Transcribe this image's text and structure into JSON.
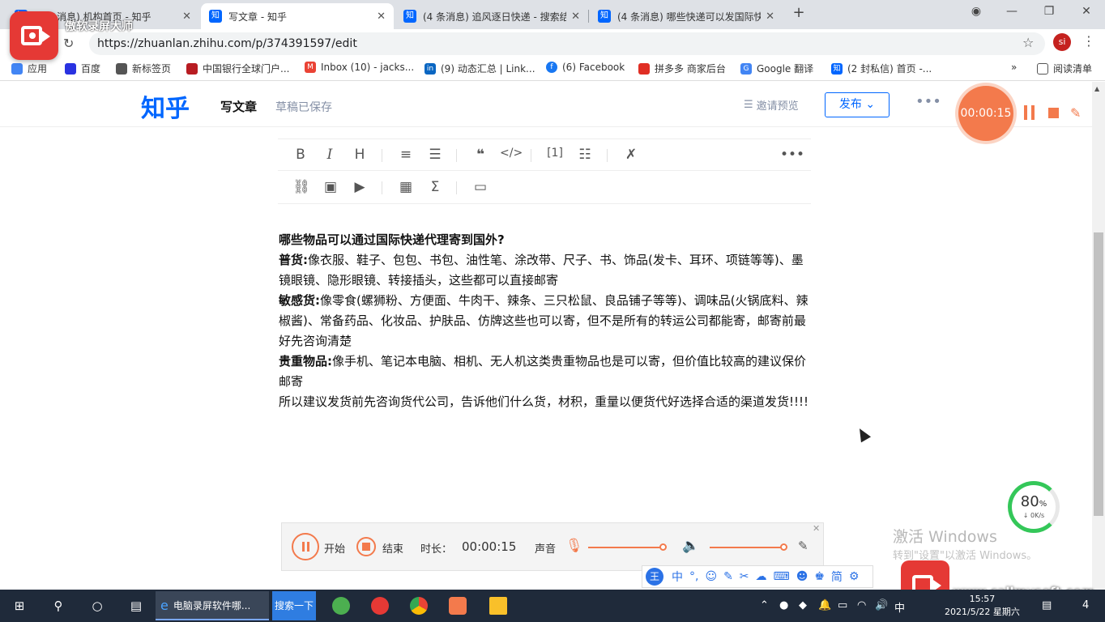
{
  "tabs": [
    {
      "title": "(4 条消息) 机构首页 - 知乎",
      "active": false
    },
    {
      "title": "写文章 - 知乎",
      "active": true
    },
    {
      "title": "(4 条消息) 追风逐日快递 - 搜索结",
      "active": false
    },
    {
      "title": "(4 条消息) 哪些快递可以发国际快",
      "active": false
    }
  ],
  "recorder_title": "傲软录屏大师",
  "address": {
    "url": "https://zhuanlan.zhihu.com/p/374391597/edit"
  },
  "profile": "si",
  "bookmarks": [
    {
      "label": "应用",
      "color": "#4285f4"
    },
    {
      "label": "百度",
      "color": "#2932e1"
    },
    {
      "label": "新标签页",
      "color": "#555555"
    },
    {
      "label": "中国银行全球门户...",
      "color": "#b81c22"
    },
    {
      "label": "Inbox (10) - jacks...",
      "color": "#ea4335"
    },
    {
      "label": "(9) 动态汇总 | Link...",
      "color": "#0a66c2"
    },
    {
      "label": "(6) Facebook",
      "color": "#1877f2"
    },
    {
      "label": "拼多多 商家后台",
      "color": "#e02e24"
    },
    {
      "label": "Google 翻译",
      "color": "#4285f4"
    },
    {
      "label": "(2 封私信) 首页 -...",
      "color": "#0066ff"
    }
  ],
  "bookmarks_overflow": "»",
  "reading_list": "阅读清单",
  "zhihu": {
    "logo": "知乎",
    "page_title": "写文章",
    "saved_status": "草稿已保存",
    "preview": "邀请预览",
    "publish": "发布",
    "more": "•••"
  },
  "toolbar": {
    "row1": [
      "B",
      "I",
      "H"
    ],
    "more": "•••"
  },
  "article": {
    "heading": "哪些物品可以通过国际快递代理寄到国外?",
    "p1_label": "普货:",
    "p1_text": "像衣服、鞋子、包包、书包、油性笔、涂改带、尺子、书、饰品(发卡、耳环、项链等等)、墨镜眼镜、隐形眼镜、转接插头，这些都可以直接邮寄",
    "p2_label": "敏感货:",
    "p2_text": "像零食(螺狮粉、方便面、牛肉干、辣条、三只松鼠、良品铺子等等)、调味品(火锅底料、辣椒酱)、常备药品、化妆品、护肤品、仿牌这些也可以寄，但不是所有的转运公司都能寄，邮寄前最好先咨询清楚",
    "p3_label": "贵重物品:",
    "p3_text": "像手机、笔记本电脑、相机、无人机这类贵重物品也是可以寄，但价值比较高的建议保价邮寄",
    "p4_text": "所以建议发货前先咨询货代公司，告诉他们什么货，材积，重量以便货代好选择合适的渠道发货!!!!"
  },
  "timer": {
    "time": "00:00:15"
  },
  "recbar": {
    "start_label": "开始",
    "end_label": "结束",
    "duration_label": "时长：",
    "duration_value": "00:00:15",
    "sound_label": "声音"
  },
  "watermark": {
    "line1": "激活 Windows",
    "line2": "转到\"设置\"以激活 Windows。"
  },
  "gauge": {
    "percent": "80",
    "percent_unit": "%",
    "speed": "↓ 0K/s"
  },
  "site_watermark": "www.callmysoft.com",
  "taskbar": {
    "ie_label": "电脑录屏软件哪...",
    "search_label": "搜索一下",
    "ime_lang": "中",
    "clock_time": "15:57",
    "clock_date": "2021/5/22 星期六",
    "notification_count": "4"
  },
  "ime": {
    "logo": "王",
    "lang": "中"
  }
}
